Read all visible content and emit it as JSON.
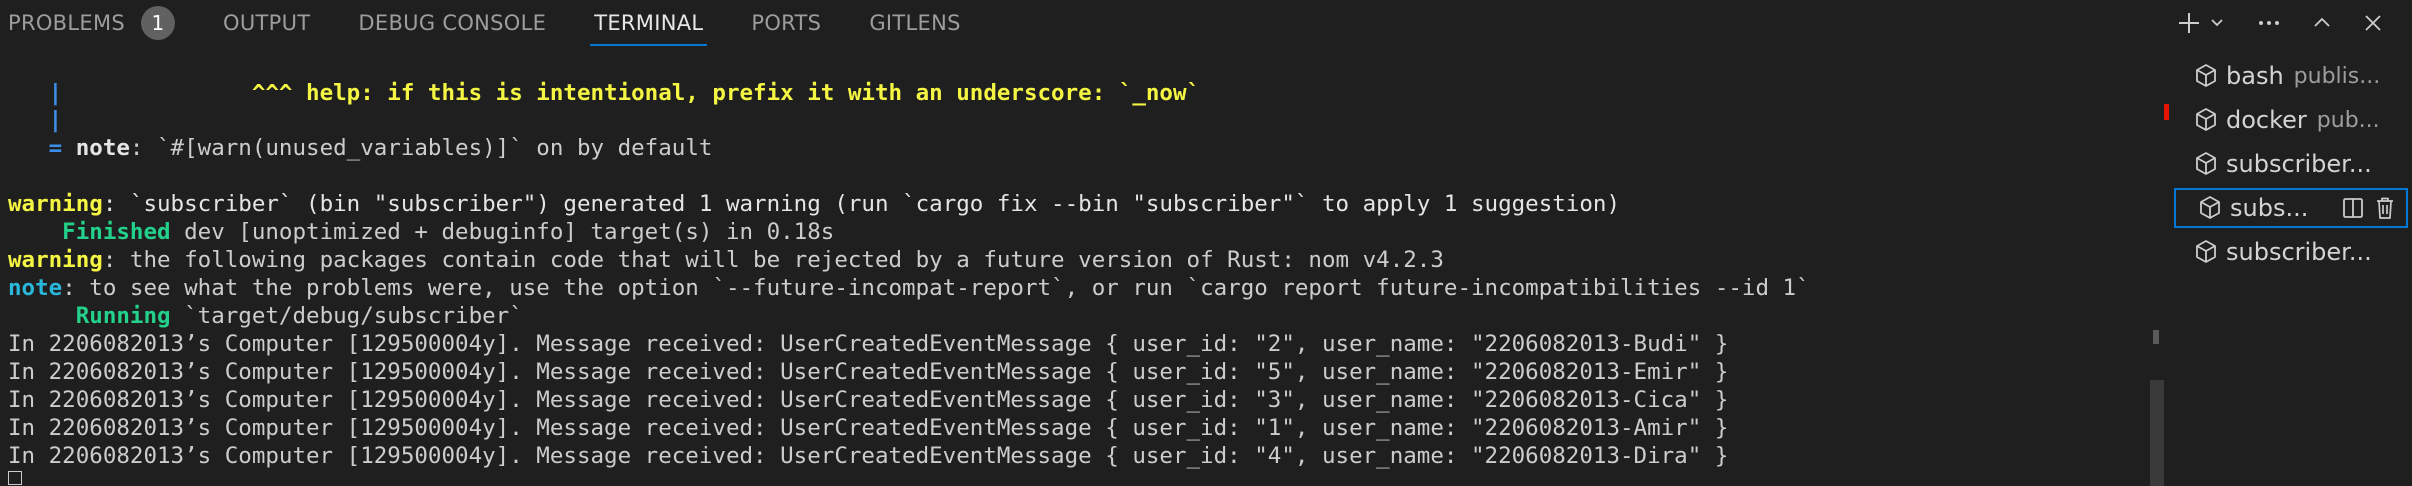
{
  "tabs": [
    {
      "label": "PROBLEMS",
      "badge": "1"
    },
    {
      "label": "OUTPUT"
    },
    {
      "label": "DEBUG CONSOLE"
    },
    {
      "label": "TERMINAL"
    },
    {
      "label": "PORTS"
    },
    {
      "label": "GITLENS"
    }
  ],
  "actions": {
    "new_terminal": "plus-icon",
    "launch_profile": "chevron-down-icon",
    "more": "ellipsis-icon",
    "maximize": "chevron-up-icon",
    "close": "close-icon"
  },
  "terminal": {
    "l1_pipe": "   |",
    "l1_help": "              ^^^ help: if this is intentional, prefix it with an underscore: `_now`",
    "l2_pipe": "   |",
    "l3_eq": "   = ",
    "l3_note": "note",
    "l3_text": ": `#[warn(unused_variables)]` on by default",
    "l5_warning": "warning",
    "l5_text": ": `subscriber` (bin \"subscriber\") generated 1 warning (run `cargo fix --bin \"subscriber\"` to apply 1 suggestion)",
    "l6_finished": "    Finished",
    "l6_text": " dev [unoptimized + debuginfo] target(s) in 0.18s",
    "l7_warning": "warning",
    "l7_text": ": the following packages contain code that will be rejected by a future version of Rust: nom v4.2.3",
    "l8_note": "note",
    "l8_text": ": to see what the problems were, use the option `--future-incompat-report`, or run `cargo report future-incompatibilities --id 1`",
    "l9_running": "     Running",
    "l9_text": " `target/debug/subscriber`",
    "messages": [
      "In 2206082013’s Computer [129500004y]. Message received: UserCreatedEventMessage { user_id: \"2\", user_name: \"2206082013-Budi\" }",
      "In 2206082013’s Computer [129500004y]. Message received: UserCreatedEventMessage { user_id: \"5\", user_name: \"2206082013-Emir\" }",
      "In 2206082013’s Computer [129500004y]. Message received: UserCreatedEventMessage { user_id: \"3\", user_name: \"2206082013-Cica\" }",
      "In 2206082013’s Computer [129500004y]. Message received: UserCreatedEventMessage { user_id: \"1\", user_name: \"2206082013-Amir\" }",
      "In 2206082013’s Computer [129500004y]. Message received: UserCreatedEventMessage { user_id: \"4\", user_name: \"2206082013-Dira\" }"
    ]
  },
  "terminal_list": [
    {
      "name": "bash",
      "desc": "publis..."
    },
    {
      "name": "docker",
      "desc": "pub..."
    },
    {
      "name": "subscriber...",
      "desc": ""
    },
    {
      "name": "subs...",
      "desc": "",
      "active": true
    },
    {
      "name": "subscriber...",
      "desc": ""
    }
  ],
  "colors": {
    "background": "#1f1f1f",
    "accent": "#0078d4",
    "warning": "#e5e510",
    "note": "#3b8eea",
    "success": "#23d18b",
    "error_marker": "#e51400"
  }
}
